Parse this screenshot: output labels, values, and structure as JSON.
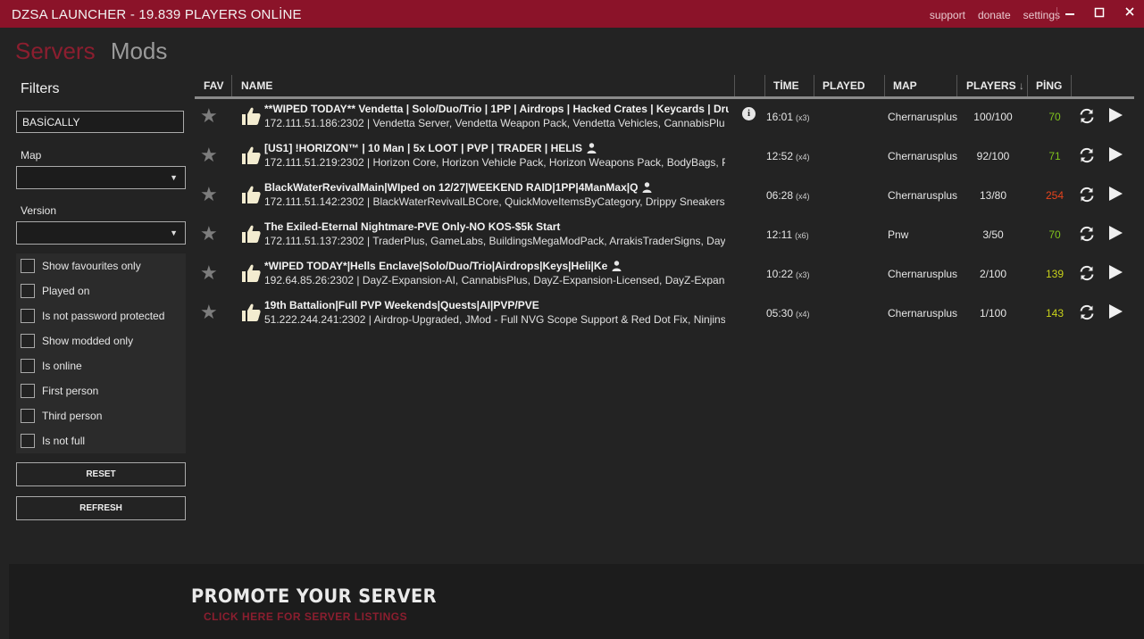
{
  "window": {
    "title": "DZSA LAUNCHER - 19.839 PLAYERS ONLİNE",
    "links": [
      "support",
      "donate",
      "settings"
    ],
    "minimize": "‗",
    "maximize": "▢",
    "close": "✕"
  },
  "tabs": {
    "servers": "Servers",
    "mods": "Mods"
  },
  "filters": {
    "title": "Filters",
    "search_value": "BASİCALLY",
    "map_label": "Map",
    "version_label": "Version",
    "checkboxes": [
      "Show favourites only",
      "Played on",
      "Is not password protected",
      "Show modded only",
      "Is online",
      "First person",
      "Third person",
      "Is not full"
    ],
    "reset_label": "RESET",
    "refresh_label": "REFRESH"
  },
  "table": {
    "headers": {
      "fav": "FAV",
      "name": "NAME",
      "time": "TİME",
      "played": "PLAYED",
      "map": "MAP",
      "players": "PLAYERS",
      "players_sort": "↓",
      "ping": "PİNG"
    },
    "rows": [
      {
        "name": "**WIPED TODAY** Vendetta | Solo/Duo/Trio | 1PP | Airdrops | Hacked Crates | Keycards | Dru",
        "desc": "172.111.51.186:2302 | Vendetta Server, Vendetta Weapon Pack, Vendetta Vehicles, CannabisPlus, A",
        "info": "i",
        "time": "16:01",
        "mult": "(x3)",
        "map": "Chernarusplus",
        "players": "100/100",
        "ping": "70",
        "ping_color": "#7fc31c",
        "person": false
      },
      {
        "name": "[US1] !HORIZON™ | 10 Man | 5x LOOT | PVP | TRADER | HELIS",
        "desc": "172.111.51.219:2302 | Horizon Core, Horizon Vehicle Pack, Horizon Weapons Pack, BodyBags, Para",
        "info": "",
        "time": "12:52",
        "mult": "(x4)",
        "map": "Chernarusplus",
        "players": "92/100",
        "ping": "71",
        "ping_color": "#7fc31c",
        "person": true
      },
      {
        "name": "BlackWaterRevivalMain|WIped on 12/27|WEEKEND RAID|1PP|4ManMax|Q",
        "desc": "172.111.51.142:2302 | BlackWaterRevivalLBCore, QuickMoveItemsByCategory, Drippy Sneakers, Mu",
        "info": "",
        "time": "06:28",
        "mult": "(x4)",
        "map": "Chernarusplus",
        "players": "13/80",
        "ping": "254",
        "ping_color": "#e8431c",
        "person": true
      },
      {
        "name": "The Exiled-Eternal Nightmare-PVE Only-NO KOS-$5k Start",
        "desc": "172.111.51.137:2302 | TraderPlus, GameLabs, BuildingsMegaModPack, ArrakisTraderSigns, DayZ Ec",
        "info": "",
        "time": "12:11",
        "mult": "(x6)",
        "map": "Pnw",
        "players": "3/50",
        "ping": "70",
        "ping_color": "#7fc31c",
        "person": false
      },
      {
        "name": "*WIPED TODAY*|Hells Enclave|Solo/Duo/Trio|Airdrops|Keys|Heli|Ke",
        "desc": "192.64.85.26:2302 | DayZ-Expansion-AI, CannabisPlus, DayZ-Expansion-Licensed, DayZ-Expansion-",
        "info": "",
        "time": "10:22",
        "mult": "(x3)",
        "map": "Chernarusplus",
        "players": "2/100",
        "ping": "139",
        "ping_color": "#c8d11a",
        "person": true
      },
      {
        "name": "19th Battalion|Full PVP Weekends|Quests|AI|PVP/PVE",
        "desc": "51.222.244.241:2302 | Airdrop-Upgraded, JMod - Full NVG Scope Support & Red Dot Fix, Ninjins-I",
        "info": "",
        "time": "05:30",
        "mult": "(x4)",
        "map": "Chernarusplus",
        "players": "1/100",
        "ping": "143",
        "ping_color": "#c8d11a",
        "person": false
      }
    ]
  },
  "banner": {
    "line1": "PROMOTE YOUR SERVER",
    "line2": "CLICK HERE FOR SERVER LISTINGS"
  }
}
